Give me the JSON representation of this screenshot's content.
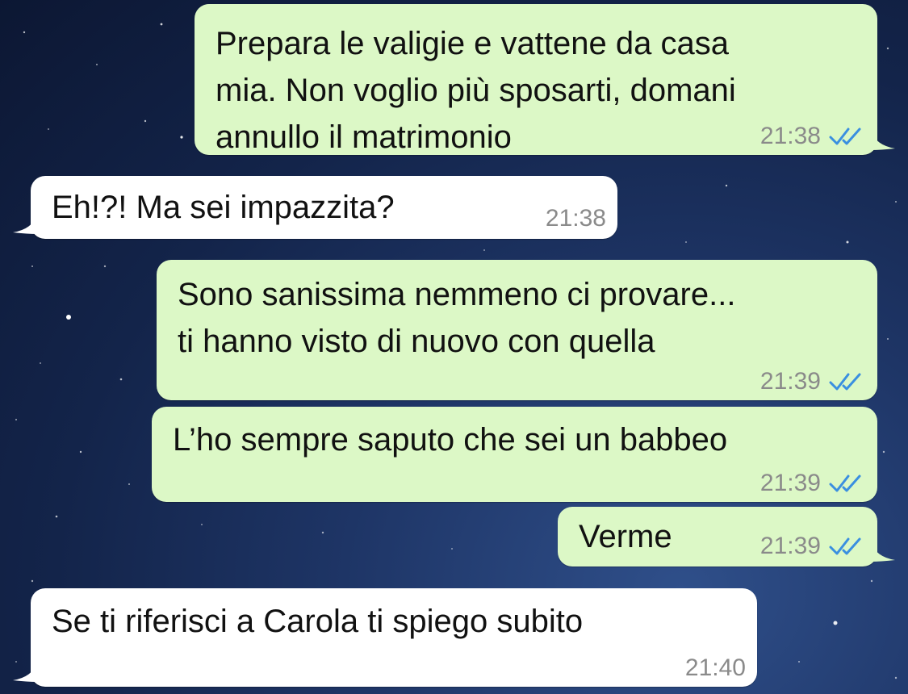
{
  "colors": {
    "outgoing_bubble": "#dcf8c6",
    "incoming_bubble": "#ffffff",
    "read_ticks": "#3a8fe0",
    "timestamp": "#8a8a8a"
  },
  "messages": [
    {
      "direction": "outgoing",
      "text": "Prepara le valigie e vattene da casa\nmia. Non voglio più sposarti, domani\nannullo il matrimonio",
      "time": "21:38",
      "status_icon": "double-check-read-icon"
    },
    {
      "direction": "incoming",
      "text": "Eh!?! Ma sei impazzita?",
      "time": "21:38"
    },
    {
      "direction": "outgoing",
      "text": "Sono sanissima nemmeno ci provare...\nti hanno visto di nuovo con quella",
      "time": "21:39",
      "status_icon": "double-check-read-icon"
    },
    {
      "direction": "outgoing",
      "text": "L’ho sempre saputo che sei un babbeo",
      "time": "21:39",
      "status_icon": "double-check-read-icon"
    },
    {
      "direction": "outgoing",
      "text": "Verme",
      "time": "21:39",
      "status_icon": "double-check-read-icon"
    },
    {
      "direction": "incoming",
      "text": "Se ti riferisci a Carola ti spiego subito",
      "time": "21:40"
    }
  ]
}
